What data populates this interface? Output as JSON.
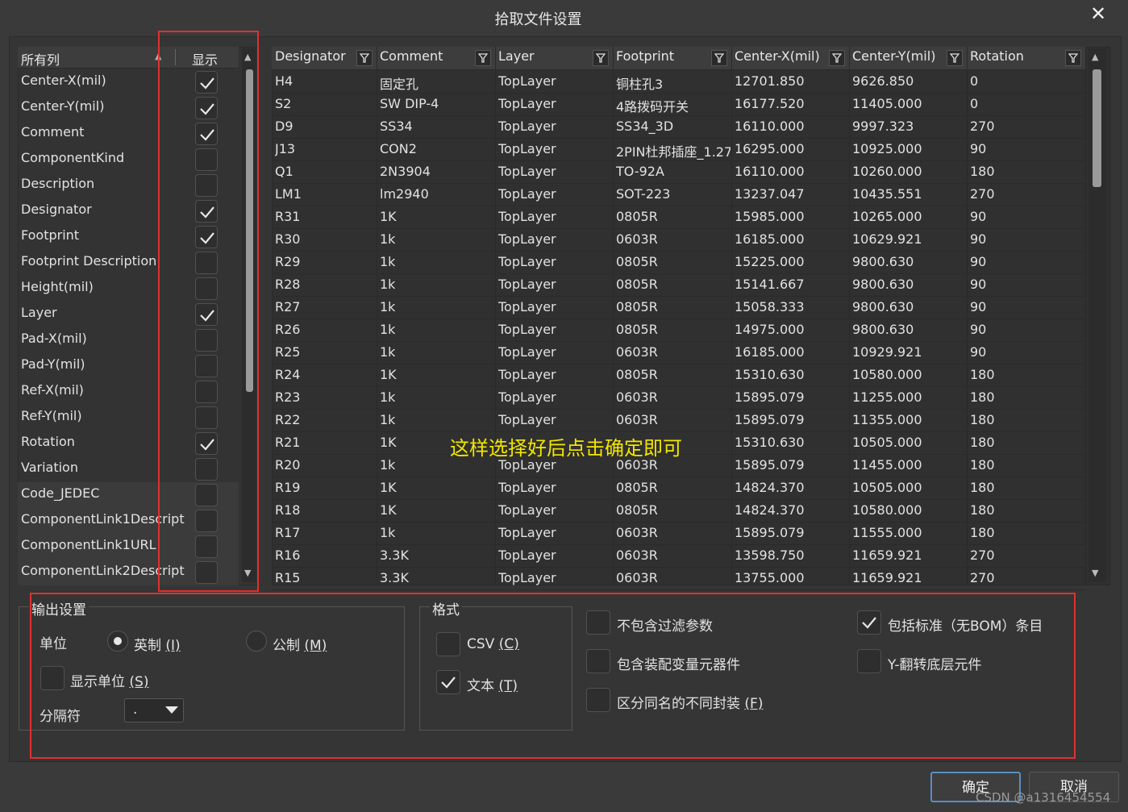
{
  "window": {
    "title": "拾取文件设置",
    "close": "✕"
  },
  "left_list": {
    "header_name": "所有列",
    "header_show": "显示",
    "items": [
      {
        "label": "Center-X(mil)",
        "checked": true
      },
      {
        "label": "Center-Y(mil)",
        "checked": true
      },
      {
        "label": "Comment",
        "checked": true
      },
      {
        "label": "ComponentKind",
        "checked": false
      },
      {
        "label": "Description",
        "checked": false
      },
      {
        "label": "Designator",
        "checked": true
      },
      {
        "label": "Footprint",
        "checked": true
      },
      {
        "label": "Footprint Description",
        "checked": false
      },
      {
        "label": "Height(mil)",
        "checked": false
      },
      {
        "label": "Layer",
        "checked": true
      },
      {
        "label": "Pad-X(mil)",
        "checked": false
      },
      {
        "label": "Pad-Y(mil)",
        "checked": false
      },
      {
        "label": "Ref-X(mil)",
        "checked": false
      },
      {
        "label": "Ref-Y(mil)",
        "checked": false
      },
      {
        "label": "Rotation",
        "checked": true
      },
      {
        "label": "Variation",
        "checked": false
      },
      {
        "label": "Code_JEDEC",
        "checked": false
      },
      {
        "label": "ComponentLink1Descript",
        "checked": false
      },
      {
        "label": "ComponentLink1URL",
        "checked": false
      },
      {
        "label": "ComponentLink2Descript",
        "checked": false
      }
    ]
  },
  "grid": {
    "columns": [
      "Designator",
      "Comment",
      "Layer",
      "Footprint",
      "Center-X(mil)",
      "Center-Y(mil)",
      "Rotation"
    ],
    "rows": [
      [
        "H4",
        "固定孔",
        "TopLayer",
        "铜柱孔3",
        "12701.850",
        "9626.850",
        "0"
      ],
      [
        "S2",
        "SW DIP-4",
        "TopLayer",
        "4路拨码开关",
        "16177.520",
        "11405.000",
        "0"
      ],
      [
        "D9",
        "SS34",
        "TopLayer",
        "SS34_3D",
        "16110.000",
        "9997.323",
        "270"
      ],
      [
        "J13",
        "CON2",
        "TopLayer",
        "2PIN杜邦插座_1.27",
        "16295.000",
        "10925.000",
        "90"
      ],
      [
        "Q1",
        "2N3904",
        "TopLayer",
        "TO-92A",
        "16110.000",
        "10260.000",
        "180"
      ],
      [
        "LM1",
        "lm2940",
        "TopLayer",
        "SOT-223",
        "13237.047",
        "10435.551",
        "270"
      ],
      [
        "R31",
        "1K",
        "TopLayer",
        "0805R",
        "15985.000",
        "10265.000",
        "90"
      ],
      [
        "R30",
        "1k",
        "TopLayer",
        "0603R",
        "16185.000",
        "10629.921",
        "90"
      ],
      [
        "R29",
        "1k",
        "TopLayer",
        "0805R",
        "15225.000",
        "9800.630",
        "90"
      ],
      [
        "R28",
        "1k",
        "TopLayer",
        "0805R",
        "15141.667",
        "9800.630",
        "90"
      ],
      [
        "R27",
        "1k",
        "TopLayer",
        "0805R",
        "15058.333",
        "9800.630",
        "90"
      ],
      [
        "R26",
        "1k",
        "TopLayer",
        "0805R",
        "14975.000",
        "9800.630",
        "90"
      ],
      [
        "R25",
        "1k",
        "TopLayer",
        "0603R",
        "16185.000",
        "10929.921",
        "90"
      ],
      [
        "R24",
        "1K",
        "TopLayer",
        "0805R",
        "15310.630",
        "10580.000",
        "180"
      ],
      [
        "R23",
        "1k",
        "TopLayer",
        "0603R",
        "15895.079",
        "11255.000",
        "180"
      ],
      [
        "R22",
        "1k",
        "TopLayer",
        "0603R",
        "15895.079",
        "11355.000",
        "180"
      ],
      [
        "R21",
        "1K",
        "",
        "",
        "15310.630",
        "10505.000",
        "180"
      ],
      [
        "R20",
        "1k",
        "TopLayer",
        "0603R",
        "15895.079",
        "11455.000",
        "180"
      ],
      [
        "R19",
        "1K",
        "TopLayer",
        "0805R",
        "14824.370",
        "10505.000",
        "180"
      ],
      [
        "R18",
        "1K",
        "TopLayer",
        "0805R",
        "14824.370",
        "10580.000",
        "180"
      ],
      [
        "R17",
        "1k",
        "TopLayer",
        "0603R",
        "15895.079",
        "11555.000",
        "180"
      ],
      [
        "R16",
        "3.3K",
        "TopLayer",
        "0603R",
        "13598.750",
        "11659.921",
        "270"
      ],
      [
        "R15",
        "3.3K",
        "TopLayer",
        "0603R",
        "13755.000",
        "11659.921",
        "270"
      ]
    ]
  },
  "annotation": "这样选择好后点击确定即可",
  "output_settings": {
    "group_label": "输出设置",
    "unit_label": "单位",
    "imperial_label": "英制 ",
    "imperial_key": "(I)",
    "metric_label": "公制 ",
    "metric_key": "(M)",
    "unit_selected": "imperial",
    "show_units_label": "显示单位 ",
    "show_units_key": "(S)",
    "separator_label": "分隔符",
    "separator_value": "."
  },
  "format": {
    "group_label": "格式",
    "csv_label": "CSV ",
    "csv_key": "(C)",
    "csv_checked": false,
    "text_label": "文本 ",
    "text_key": "(T)",
    "text_checked": true
  },
  "options": {
    "exclude_filter": {
      "label": "不包含过滤参数",
      "checked": false
    },
    "include_variant": {
      "label": "包含装配变量元器件",
      "checked": false
    },
    "distinguish_footprints": {
      "label": "区分同名的不同封装 ",
      "key": "(F)",
      "checked": false
    },
    "include_standard": {
      "label": "包括标准（无BOM）条目",
      "checked": true
    },
    "y_flip": {
      "label": "Y-翻转底层元件",
      "checked": false
    }
  },
  "buttons": {
    "ok": "确定",
    "cancel": "取消"
  },
  "watermark": "CSDN @a1316454554",
  "colors": {
    "highlight": "#e03030",
    "annotation": "#f2e600",
    "primary_border": "#5a8ec2"
  }
}
